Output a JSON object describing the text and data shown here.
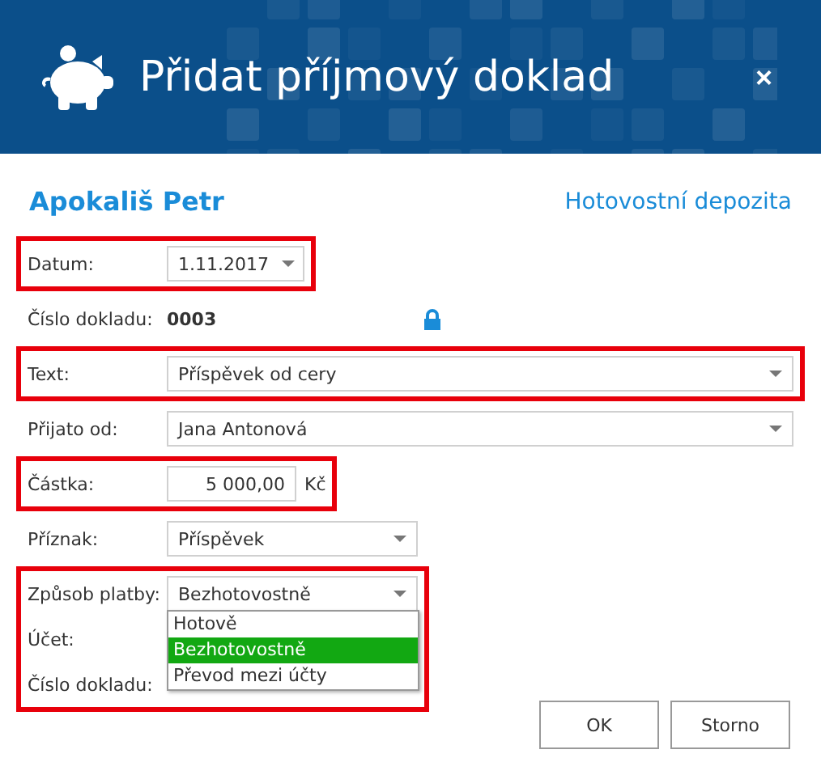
{
  "window": {
    "title": "Přidat příjmový doklad",
    "close": "×"
  },
  "header": {
    "name": "Apokališ Petr",
    "section": "Hotovostní depozita"
  },
  "groups": [
    {
      "highlighted": true,
      "rows": [
        {
          "kind": "date",
          "label": "Datum:",
          "value": "1.11.2017"
        }
      ]
    },
    {
      "highlighted": false,
      "rows": [
        {
          "kind": "static",
          "label": "Číslo dokladu:",
          "value": "0003",
          "locked": true
        }
      ]
    },
    {
      "highlighted": true,
      "rows": [
        {
          "kind": "combo-wide",
          "label": "Text:",
          "value": "Příspěvek od cery"
        }
      ]
    },
    {
      "highlighted": false,
      "rows": [
        {
          "kind": "combo-wide",
          "label": "Přijato od:",
          "value": "Jana Antonová"
        }
      ]
    },
    {
      "highlighted": true,
      "rows": [
        {
          "kind": "amount",
          "label": "Částka:",
          "value": "5 000,00",
          "unit": "Kč"
        }
      ]
    },
    {
      "highlighted": false,
      "rows": [
        {
          "kind": "combo",
          "label": "Příznak:",
          "value": "Příspěvek"
        }
      ]
    },
    {
      "highlighted": true,
      "rows": [
        {
          "kind": "combo",
          "label": "Způsob platby:",
          "value": "Bezhotovostně",
          "expanded": true,
          "options": [
            {
              "label": "Hotově",
              "selected": false
            },
            {
              "label": "Bezhotovostně",
              "selected": true
            },
            {
              "label": "Převod mezi účty",
              "selected": false
            }
          ]
        },
        {
          "kind": "label",
          "label": "Účet:"
        },
        {
          "kind": "label",
          "label": "Číslo dokladu:"
        }
      ]
    }
  ],
  "buttons": [
    "OK",
    "Storno"
  ]
}
